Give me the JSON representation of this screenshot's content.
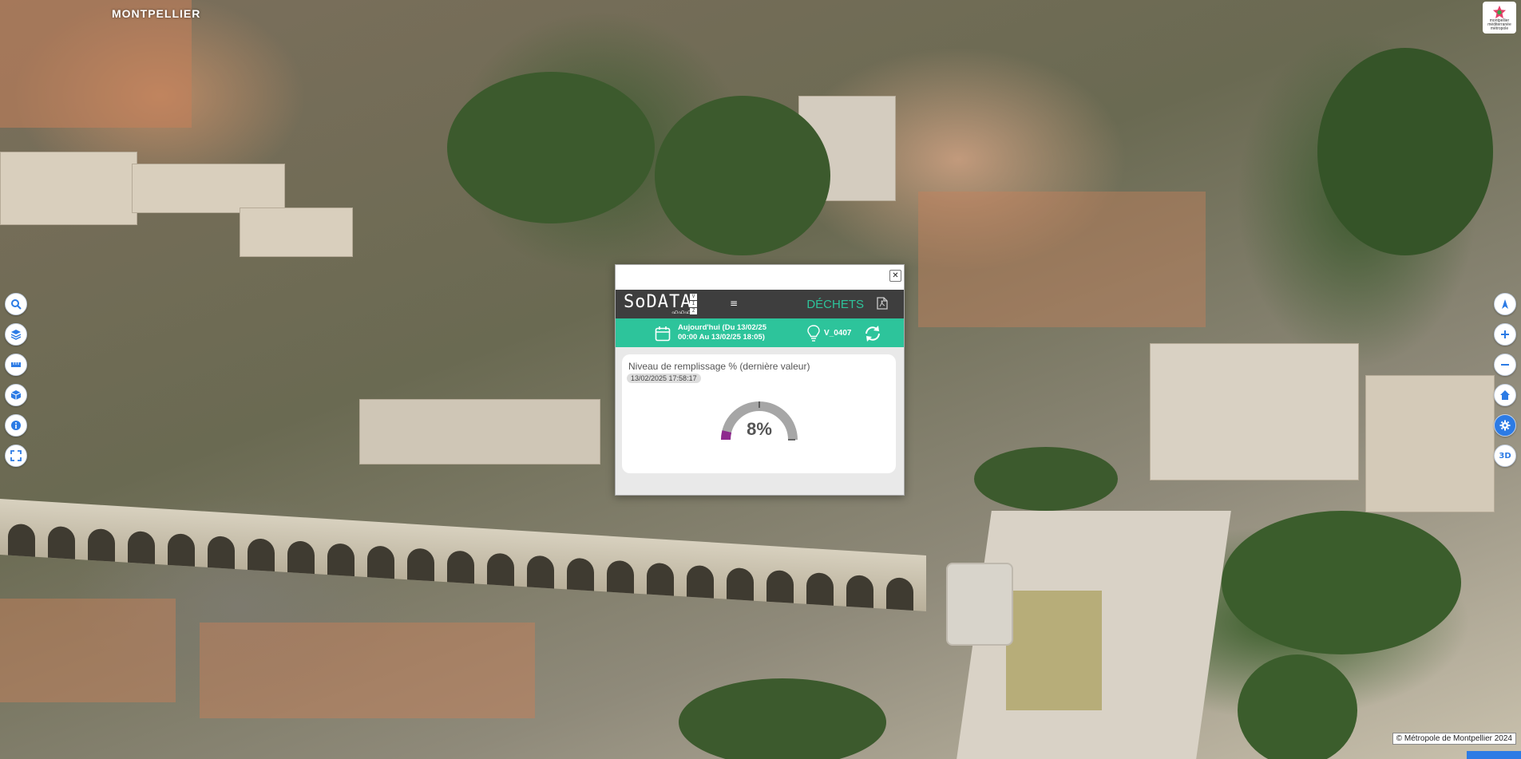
{
  "map": {
    "city_label": "MONTPELLIER",
    "brand_logo_text": "montpellier méditerranée métropole",
    "copyright": "© Métropole de Montpellier 2024"
  },
  "tools_left": [
    {
      "icon": "search-icon"
    },
    {
      "icon": "layers-icon"
    },
    {
      "icon": "ruler-icon"
    },
    {
      "icon": "cube-icon"
    },
    {
      "icon": "info-icon"
    },
    {
      "icon": "fullscreen-icon"
    }
  ],
  "tools_right": [
    {
      "icon": "compass-icon"
    },
    {
      "icon": "zoom-in-icon"
    },
    {
      "icon": "zoom-out-icon"
    },
    {
      "icon": "home-icon"
    },
    {
      "icon": "settings-icon",
      "active": true
    },
    {
      "icon": "3d-icon",
      "label": "3D"
    }
  ],
  "popup": {
    "close_label": "✕",
    "logo": "SoDATA",
    "logo_viz": [
      "V",
      "I",
      "Z"
    ],
    "logo_sub": "ഹഹഹ",
    "menu_glyph": "≡",
    "title": "DÉCHETS",
    "date_line1": "Aujourd'hui (Du 13/02/25",
    "date_line2": "00:00 Au 13/02/25 18:05)",
    "sensor_id": "V_0407",
    "card": {
      "title": "Niveau de remplissage % (dernière valeur)",
      "timestamp": "13/02/2025 17:58:17",
      "gauge_value": "8%",
      "fill_fraction": 0.08
    }
  },
  "colors": {
    "accent_green": "#2dc49b",
    "header_dark": "#3e3e3e",
    "gauge_fill": "#8e2a8e",
    "tool_blue": "#2c7be5"
  }
}
